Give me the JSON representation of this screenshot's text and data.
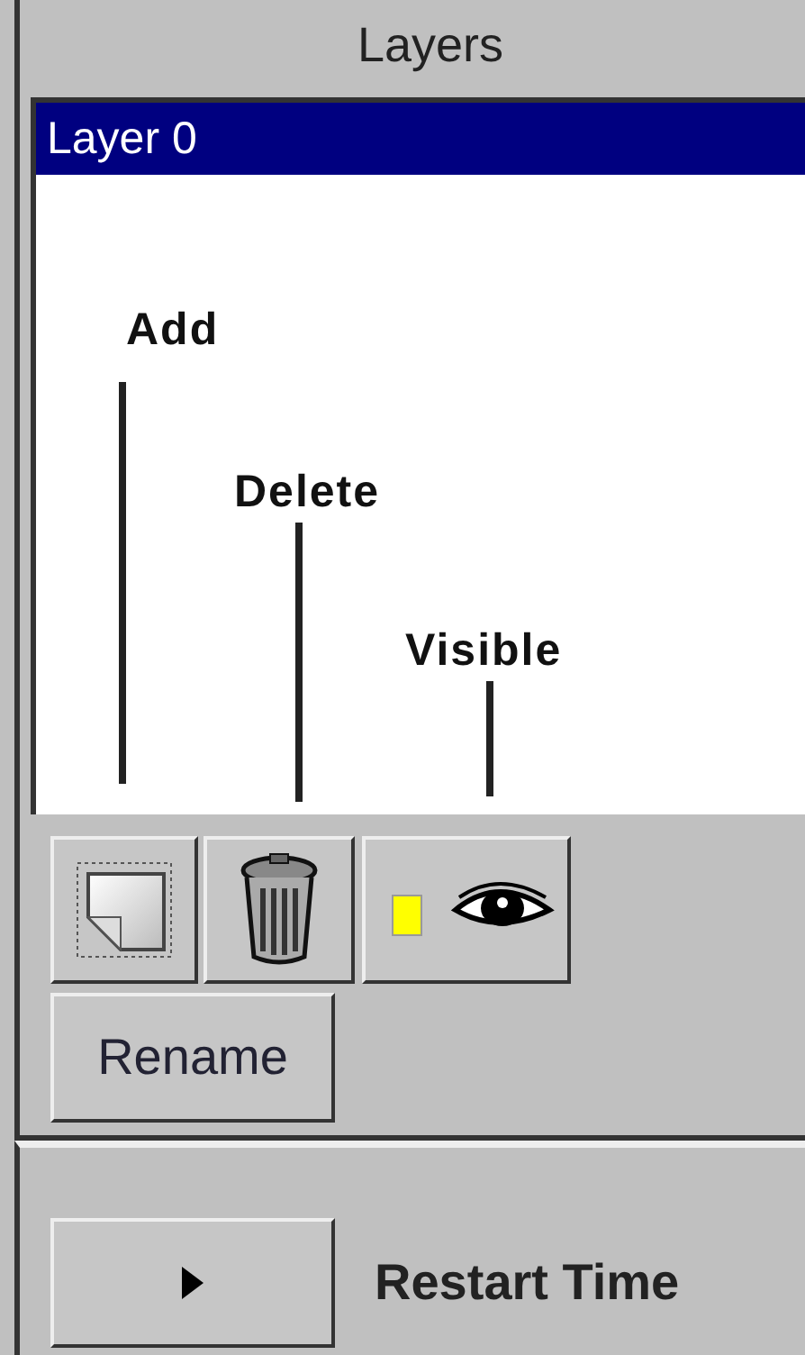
{
  "panel": {
    "title": "Layers"
  },
  "layers": [
    {
      "name": "Layer 0",
      "selected": true
    }
  ],
  "callouts": [
    {
      "label": "Add"
    },
    {
      "label": "Delete"
    },
    {
      "label": "Visible"
    }
  ],
  "tool_buttons": [
    {
      "kind": "add"
    },
    {
      "kind": "delete"
    },
    {
      "kind": "visible"
    }
  ],
  "rename_button": "Rename",
  "restart": {
    "label": "Restart Time"
  }
}
